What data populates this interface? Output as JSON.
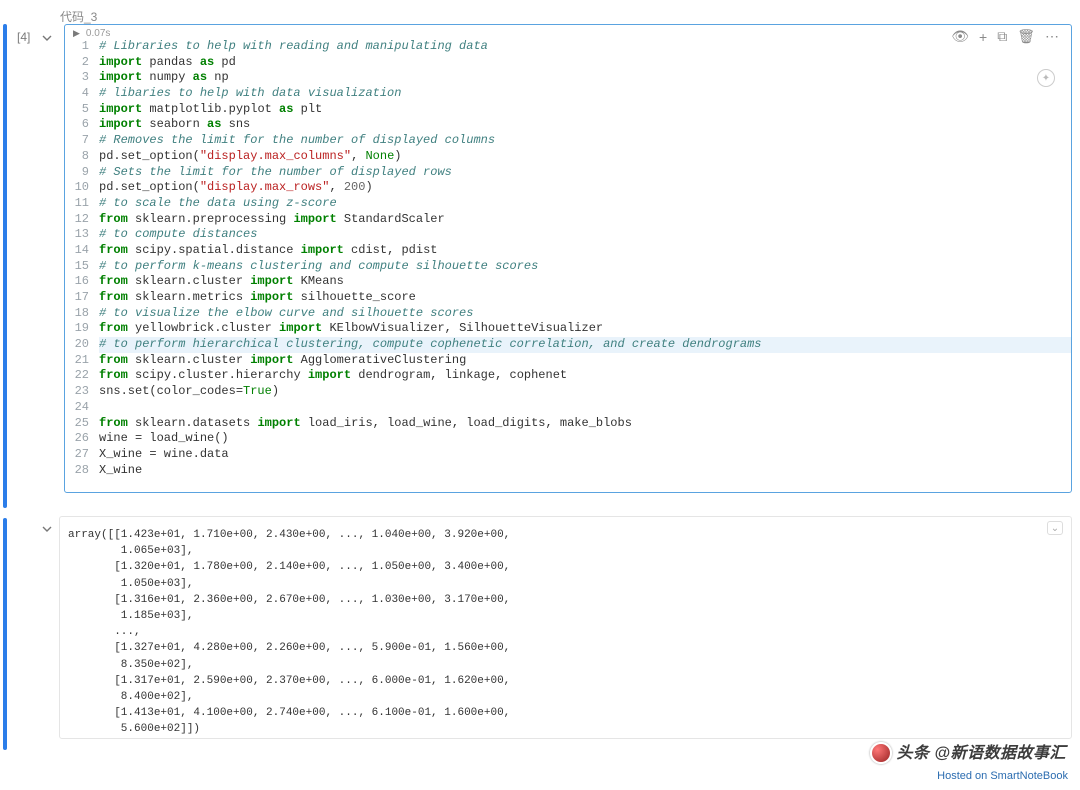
{
  "cell_label": "代码_3",
  "exec_count": "[4]",
  "run_time": "0.07s",
  "toolbar": {
    "eye": "👁",
    "plus": "+",
    "copy": "⧉",
    "trash": "🗑",
    "more": "⋯"
  },
  "code": {
    "lines": [
      {
        "n": 1,
        "t": "comment",
        "text": "# Libraries to help with reading and manipulating data"
      },
      {
        "n": 2,
        "t": "import",
        "kw": "import",
        "mod": "pandas",
        "as": "as",
        "alias": "pd"
      },
      {
        "n": 3,
        "t": "import",
        "kw": "import",
        "mod": "numpy",
        "as": "as",
        "alias": "np"
      },
      {
        "n": 4,
        "t": "comment",
        "text": "# libaries to help with data visualization"
      },
      {
        "n": 5,
        "t": "import",
        "kw": "import",
        "mod": "matplotlib.pyplot",
        "as": "as",
        "alias": "plt"
      },
      {
        "n": 6,
        "t": "import",
        "kw": "import",
        "mod": "seaborn",
        "as": "as",
        "alias": "sns"
      },
      {
        "n": 7,
        "t": "comment",
        "text": "# Removes the limit for the number of displayed columns"
      },
      {
        "n": 8,
        "t": "raw",
        "html": "pd.set_option(<span class=\"str\">\"display.max_columns\"</span>, <span class=\"bi\">None</span>)"
      },
      {
        "n": 9,
        "t": "comment",
        "text": "# Sets the limit for the number of displayed rows"
      },
      {
        "n": 10,
        "t": "raw",
        "html": "pd.set_option(<span class=\"str\">\"display.max_rows\"</span>, <span class=\"num\">200</span>)"
      },
      {
        "n": 11,
        "t": "comment",
        "text": "# to scale the data using z-score"
      },
      {
        "n": 12,
        "t": "fromimp",
        "from": "from",
        "mod": "sklearn.preprocessing",
        "imp": "import",
        "names": "StandardScaler"
      },
      {
        "n": 13,
        "t": "comment",
        "text": "# to compute distances"
      },
      {
        "n": 14,
        "t": "fromimp",
        "from": "from",
        "mod": "scipy.spatial.distance",
        "imp": "import",
        "names": "cdist, pdist"
      },
      {
        "n": 15,
        "t": "comment",
        "text": "# to perform k-means clustering and compute silhouette scores"
      },
      {
        "n": 16,
        "t": "fromimp",
        "from": "from",
        "mod": "sklearn.cluster",
        "imp": "import",
        "names": "KMeans"
      },
      {
        "n": 17,
        "t": "fromimp",
        "from": "from",
        "mod": "sklearn.metrics",
        "imp": "import",
        "names": "silhouette_score"
      },
      {
        "n": 18,
        "t": "comment",
        "text": "# to visualize the elbow curve and silhouette scores"
      },
      {
        "n": 19,
        "t": "fromimp",
        "from": "from",
        "mod": "yellowbrick.cluster",
        "imp": "import",
        "names": "KElbowVisualizer, SilhouetteVisualizer"
      },
      {
        "n": 20,
        "t": "comment",
        "text": "# to perform hierarchical clustering, compute cophenetic correlation, and create dendrograms",
        "hl": true
      },
      {
        "n": 21,
        "t": "fromimp",
        "from": "from",
        "mod": "sklearn.cluster",
        "imp": "import",
        "names": "AgglomerativeClustering"
      },
      {
        "n": 22,
        "t": "fromimp",
        "from": "from",
        "mod": "scipy.cluster.hierarchy",
        "imp": "import",
        "names": "dendrogram, linkage, cophenet"
      },
      {
        "n": 23,
        "t": "raw",
        "html": "sns.set(color_codes=<span class=\"bi\">True</span>)"
      },
      {
        "n": 24,
        "t": "blank",
        "text": ""
      },
      {
        "n": 25,
        "t": "fromimp",
        "from": "from",
        "mod": "sklearn.datasets",
        "imp": "import",
        "names": "load_iris, load_wine, load_digits, make_blobs"
      },
      {
        "n": 26,
        "t": "raw",
        "html": "wine = load_wine()"
      },
      {
        "n": 27,
        "t": "raw",
        "html": "X_wine = wine.data"
      },
      {
        "n": 28,
        "t": "raw",
        "html": "X_wine"
      }
    ]
  },
  "output_lines": [
    "array([[1.423e+01, 1.710e+00, 2.430e+00, ..., 1.040e+00, 3.920e+00,",
    "        1.065e+03],",
    "       [1.320e+01, 1.780e+00, 2.140e+00, ..., 1.050e+00, 3.400e+00,",
    "        1.050e+03],",
    "       [1.316e+01, 2.360e+00, 2.670e+00, ..., 1.030e+00, 3.170e+00,",
    "        1.185e+03],",
    "       ...,",
    "       [1.327e+01, 4.280e+00, 2.260e+00, ..., 5.900e-01, 1.560e+00,",
    "        8.350e+02],",
    "       [1.317e+01, 2.590e+00, 2.370e+00, ..., 6.000e-01, 1.620e+00,",
    "        8.400e+02],",
    "       [1.413e+01, 4.100e+00, 2.740e+00, ..., 6.100e-01, 1.600e+00,",
    "        5.600e+02]])"
  ],
  "watermark": "头条 @新语数据故事汇",
  "hosted": "Hosted on SmartNoteBook"
}
